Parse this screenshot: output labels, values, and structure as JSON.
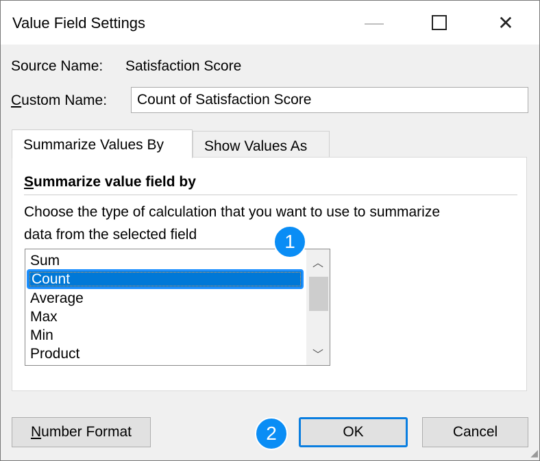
{
  "title": "Value Field Settings",
  "source_label": "Source Name:",
  "source_value": "Satisfaction Score",
  "custom_label_u": "C",
  "custom_label_rest": "ustom Name:",
  "custom_value": "Count of Satisfaction Score",
  "tabs": [
    "Summarize Values By",
    "Show Values As"
  ],
  "section_u": "S",
  "section_rest": "ummarize value field by",
  "description_1": "Choose the type of calculation that you want to use to summarize",
  "description_2": "data from the selected field",
  "list_items": [
    "Sum",
    "Count",
    "Average",
    "Max",
    "Min",
    "Product"
  ],
  "selected": "Count",
  "buttons": {
    "number_u": "N",
    "number_rest": "umber Format",
    "ok": "OK",
    "cancel": "Cancel"
  },
  "badges": [
    "1",
    "2"
  ]
}
